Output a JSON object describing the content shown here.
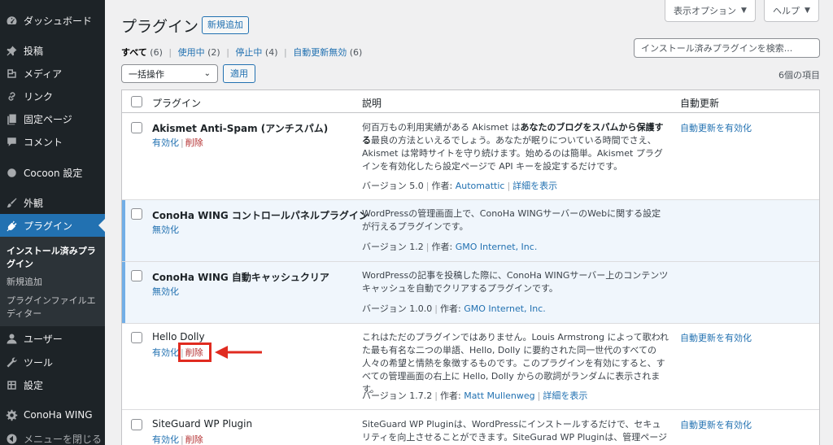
{
  "sidebar": {
    "items": [
      {
        "label": "ダッシュボード",
        "icon": "dashboard-icon"
      },
      {
        "label": "投稿",
        "icon": "pin-icon"
      },
      {
        "label": "メディア",
        "icon": "media-icon"
      },
      {
        "label": "リンク",
        "icon": "link-icon"
      },
      {
        "label": "固定ページ",
        "icon": "page-icon"
      },
      {
        "label": "コメント",
        "icon": "comment-icon"
      },
      {
        "label": "Cocoon 設定",
        "icon": "circle-icon"
      },
      {
        "label": "外観",
        "icon": "brush-icon"
      },
      {
        "label": "プラグイン",
        "icon": "plugin-icon"
      },
      {
        "label": "ユーザー",
        "icon": "user-icon"
      },
      {
        "label": "ツール",
        "icon": "wrench-icon"
      },
      {
        "label": "設定",
        "icon": "settings-icon"
      },
      {
        "label": "ConoHa WING",
        "icon": "gear-icon"
      },
      {
        "label": "メニューを閉じる",
        "icon": "collapse-icon"
      }
    ],
    "submenu": {
      "installed": "インストール済みプラグイン",
      "add_new": "新規追加",
      "editor": "プラグインファイルエディター"
    }
  },
  "header": {
    "title": "プラグイン",
    "add_new": "新規追加",
    "screen_options": "表示オプション",
    "help": "ヘルプ"
  },
  "filters": {
    "all": "すべて",
    "all_count": "(6)",
    "active": "使用中",
    "active_count": "(2)",
    "inactive": "停止中",
    "inactive_count": "(4)",
    "auto_disabled": "自動更新無効",
    "auto_disabled_count": "(6)",
    "separator": "|"
  },
  "search": {
    "placeholder": "インストール済みプラグインを検索..."
  },
  "bulk": {
    "select": "一括操作",
    "apply": "適用",
    "item_count": "6個の項目"
  },
  "table": {
    "headers": {
      "plugin": "プラグイン",
      "description": "説明",
      "auto_update": "自動更新"
    },
    "rows": [
      {
        "name": "Akismet Anti-Spam (アンチスパム)",
        "action1": "有効化",
        "action2": "削除",
        "desc_a": "何百万もの利用実績がある Akismet は",
        "desc_b": "あなたのブログをスパムから保護する",
        "desc_c": "最良の方法といえるでしょう。あなたが眠りについている時間でさえ、Akismet は常時サイトを守り続けます。始めるのは簡単。Akismet プラグインを有効化したら設定ページで API キーを設定するだけです。",
        "version": "バージョン 5.0",
        "author_label": "作者:",
        "author": "Automattic",
        "details": "詳細を表示",
        "auto": "自動更新を有効化"
      },
      {
        "name": "ConoHa WING コントロールパネルプラグイン",
        "action1": "無効化",
        "desc": "WordPressの管理画面上で、ConoHa WINGサーバーのWebに関する設定が行えるプラグインです。",
        "version": "バージョン 1.2",
        "author_label": "作者:",
        "author": "GMO Internet, Inc."
      },
      {
        "name": "ConoHa WING 自動キャッシュクリア",
        "action1": "無効化",
        "desc": "WordPressの記事を投稿した際に、ConoHa WINGサーバー上のコンテンツキャッシュを自動でクリアするプラグインです。",
        "version": "バージョン 1.0.0",
        "author_label": "作者:",
        "author": "GMO Internet, Inc."
      },
      {
        "name": "Hello Dolly",
        "action1": "有効化",
        "action2": "削除",
        "desc": "これはただのプラグインではありません。Louis Armstrong によって歌われた最も有名な二つの単語、Hello, Dolly に要約された同一世代のすべての人々の希望と情熱を象徴するものです。このプラグインを有効にすると、すべての管理画面の右上に Hello, Dolly からの歌詞がランダムに表示されます。",
        "version": "バージョン 1.7.2",
        "author_label": "作者:",
        "author": "Matt Mullenweg",
        "details": "詳細を表示",
        "auto": "自動更新を有効化"
      },
      {
        "name": "SiteGuard WP Plugin",
        "action1": "有効化",
        "action2": "削除",
        "desc": "SiteGuard WP Pluginは、WordPressにインストールするだけで、セキュリティを向上させることができます。SiteGurad WP Pluginは、管理ページとログ",
        "auto": "自動更新を有効化"
      }
    ]
  },
  "colors": {
    "sidebar_bg": "#1d2327",
    "accent": "#2271b1",
    "delete": "#b32d2e",
    "annotation": "#e02b20"
  }
}
